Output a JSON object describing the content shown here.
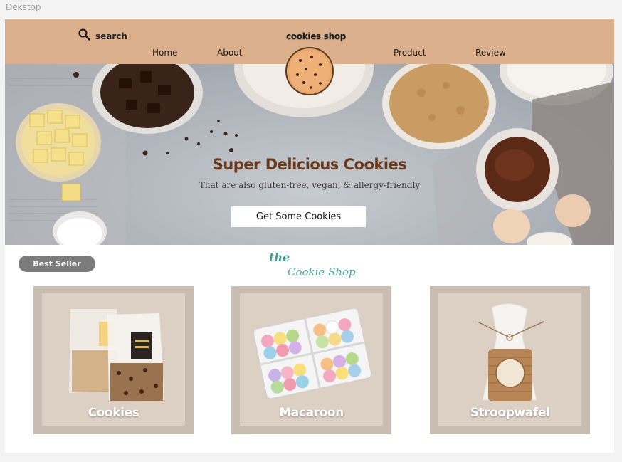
{
  "frame_label": "Dekstop",
  "header": {
    "search_label": "search",
    "brand": "cookies shop",
    "nav": {
      "home": "Home",
      "about": "About",
      "product": "Product",
      "review": "Review"
    }
  },
  "hero": {
    "title": "Super Delicious Cookies",
    "subtitle": "That are also gluten-free, vegan, & allergy-friendly",
    "cta": "Get Some Cookies"
  },
  "section": {
    "badge": "Best Seller",
    "shop_the": "the",
    "shop_name": "Cookie Shop"
  },
  "products": [
    {
      "label": "Cookies"
    },
    {
      "label": "Macaroon"
    },
    {
      "label": "Stroopwafel"
    }
  ],
  "colors": {
    "header_bg": "#dcb08c",
    "hero_title": "#6b3a1d",
    "badge_bg": "#7b7b7b",
    "card_outer": "#c9bdb1",
    "card_inner": "#dccfc4",
    "accent_teal": "#4aa89a"
  },
  "icons": [
    "search-icon",
    "cookie-logo-icon"
  ]
}
